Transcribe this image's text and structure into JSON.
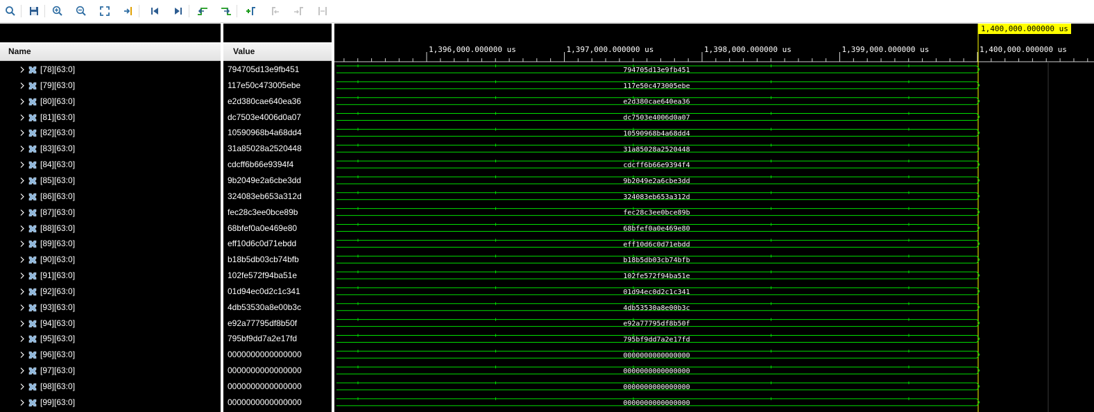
{
  "toolbar": {
    "buttons": [
      {
        "name": "search-button",
        "icon": "search-icon"
      },
      {
        "name": "save-button",
        "icon": "save-icon"
      },
      {
        "name": "zoom-in-button",
        "icon": "zoom-in-icon"
      },
      {
        "name": "zoom-out-button",
        "icon": "zoom-out-icon"
      },
      {
        "name": "zoom-fit-button",
        "icon": "zoom-fit-icon"
      },
      {
        "name": "go-to-cursor-button",
        "icon": "go-to-cursor-icon"
      },
      {
        "name": "go-to-time-zero-button",
        "icon": "skip-start-icon"
      },
      {
        "name": "go-to-last-time-button",
        "icon": "skip-end-icon"
      },
      {
        "name": "previous-transition-button",
        "icon": "previous-transition-icon"
      },
      {
        "name": "next-transition-button",
        "icon": "next-transition-icon"
      },
      {
        "name": "add-marker-button",
        "icon": "add-marker-icon"
      },
      {
        "name": "previous-marker-button",
        "icon": "previous-marker-icon",
        "disabled": true
      },
      {
        "name": "next-marker-button",
        "icon": "next-marker-icon",
        "disabled": true
      },
      {
        "name": "swap-cursors-button",
        "icon": "swap-cursors-icon",
        "disabled": true
      }
    ]
  },
  "columns": {
    "name": "Name",
    "value": "Value"
  },
  "timeline": {
    "ticks": [
      "1,396,000.000000 us",
      "1,397,000.000000 us",
      "1,398,000.000000 us",
      "1,399,000.000000 us",
      "1,400,000.000000 us"
    ],
    "cursor_label": "1,400,000.000000 us"
  },
  "signals": [
    {
      "name": "[78][63:0]",
      "value": "794705d13e9fb451"
    },
    {
      "name": "[79][63:0]",
      "value": "117e50c473005ebe"
    },
    {
      "name": "[80][63:0]",
      "value": "e2d380cae640ea36"
    },
    {
      "name": "[81][63:0]",
      "value": "dc7503e4006d0a07"
    },
    {
      "name": "[82][63:0]",
      "value": "10590968b4a68dd4"
    },
    {
      "name": "[83][63:0]",
      "value": "31a85028a2520448"
    },
    {
      "name": "[84][63:0]",
      "value": "cdcff6b66e9394f4"
    },
    {
      "name": "[85][63:0]",
      "value": "9b2049e2a6cbe3dd"
    },
    {
      "name": "[86][63:0]",
      "value": "324083eb653a312d"
    },
    {
      "name": "[87][63:0]",
      "value": "fec28c3ee0bce89b"
    },
    {
      "name": "[88][63:0]",
      "value": "68bfef0a0e469e80"
    },
    {
      "name": "[89][63:0]",
      "value": "eff10d6c0d71ebdd"
    },
    {
      "name": "[90][63:0]",
      "value": "b18b5db03cb74bfb"
    },
    {
      "name": "[91][63:0]",
      "value": "102fe572f94ba51e"
    },
    {
      "name": "[92][63:0]",
      "value": "01d94ec0d2c1c341"
    },
    {
      "name": "[93][63:0]",
      "value": "4db53530a8e00b3c"
    },
    {
      "name": "[94][63:0]",
      "value": "e92a77795df8b50f"
    },
    {
      "name": "[95][63:0]",
      "value": "795bf9dd7a2e17fd"
    },
    {
      "name": "[96][63:0]",
      "value": "0000000000000000"
    },
    {
      "name": "[97][63:0]",
      "value": "0000000000000000"
    },
    {
      "name": "[98][63:0]",
      "value": "0000000000000000"
    },
    {
      "name": "[99][63:0]",
      "value": "0000000000000000"
    }
  ],
  "colors": {
    "wave": "#00e000",
    "background": "#000000",
    "cursor_label_bg": "#ffff00",
    "text": "#ffffff"
  }
}
